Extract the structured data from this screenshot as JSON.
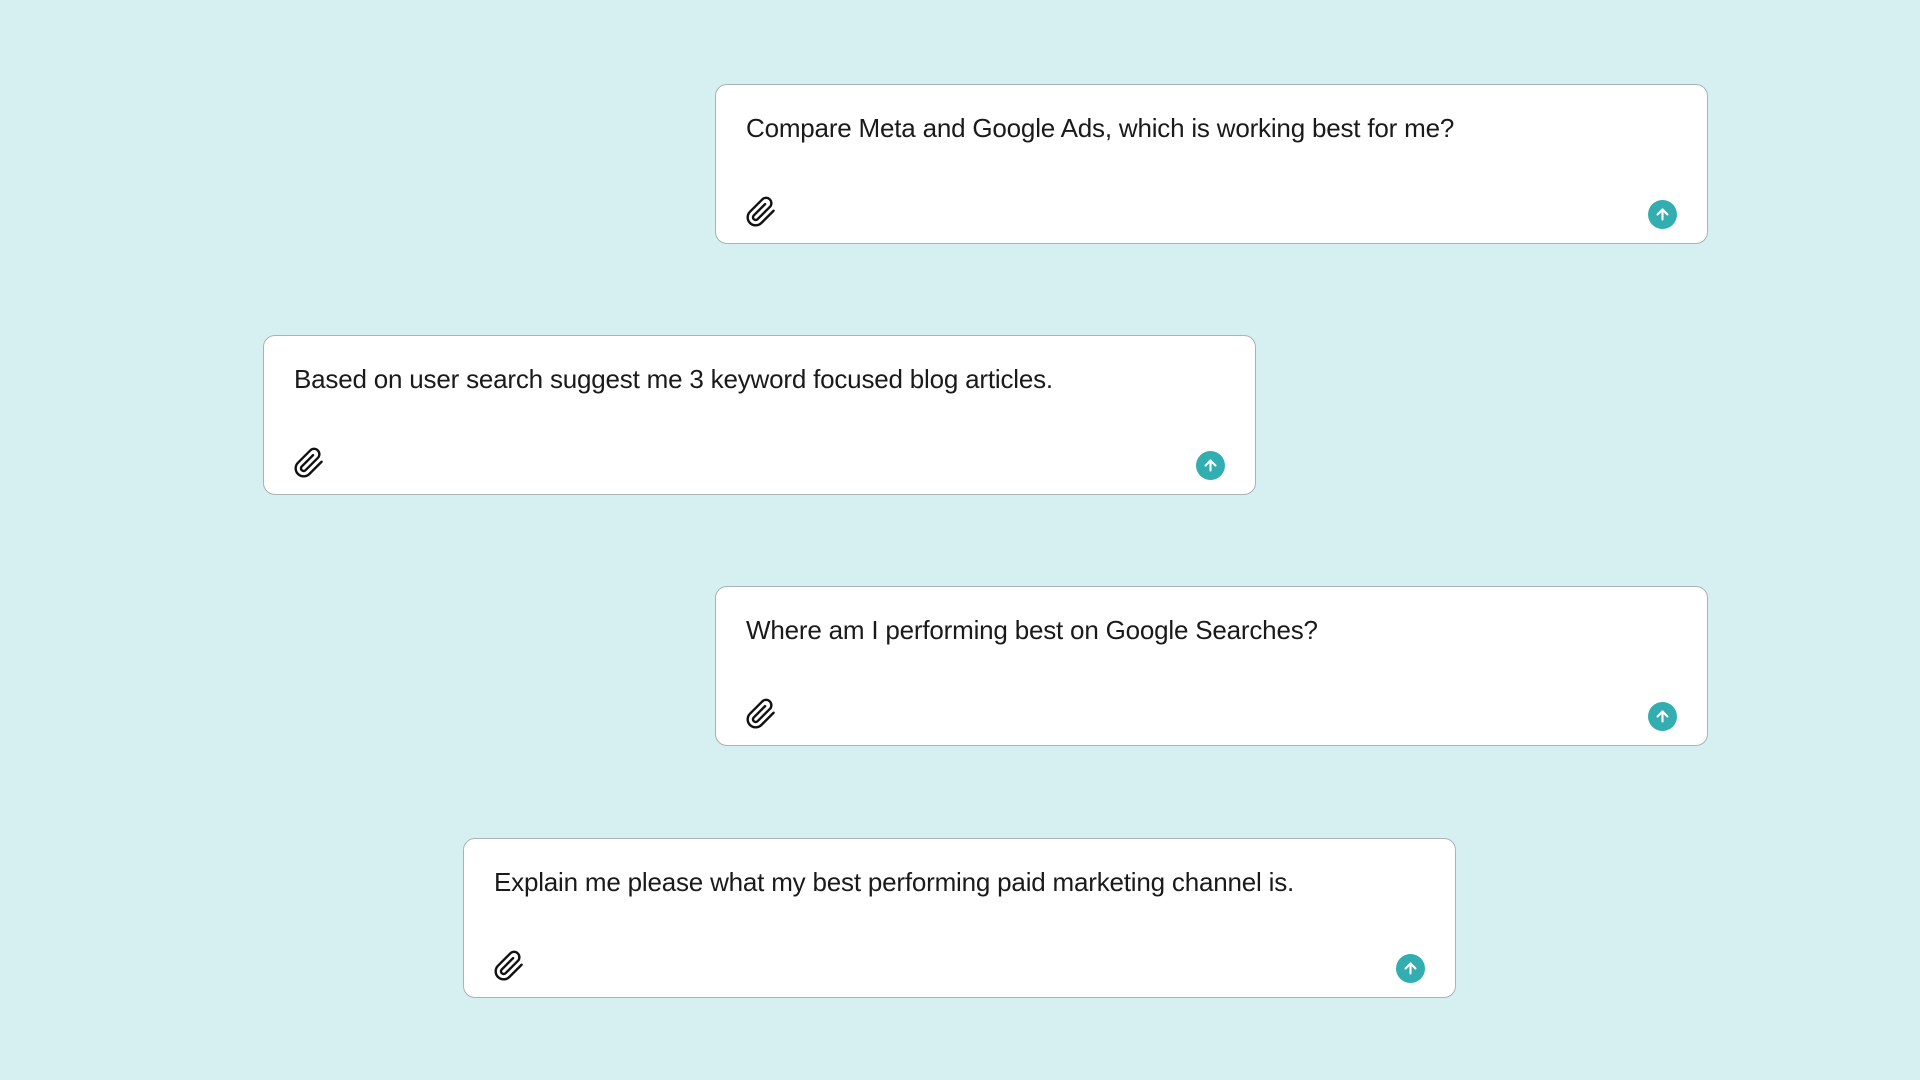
{
  "colors": {
    "background": "#d6eff0",
    "card": "#ffffff",
    "card_border": "#a9b3b5",
    "send_accent": "#33aeb0",
    "text": "#1a1a1a"
  },
  "icons": {
    "attach": "paperclip-icon",
    "send": "arrow-up-icon"
  },
  "prompts": [
    {
      "text": "Compare Meta and Google Ads, which is working best for me?"
    },
    {
      "text": "Based on user search suggest me 3 keyword focused blog articles."
    },
    {
      "text": "Where am I performing best on Google Searches?"
    },
    {
      "text": "Explain me please what my best performing paid marketing channel is."
    }
  ]
}
